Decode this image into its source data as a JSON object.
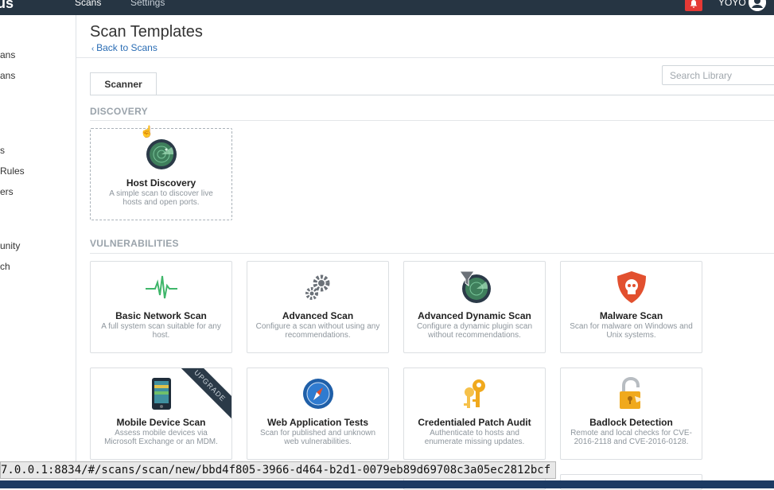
{
  "topbar": {
    "brand": "us",
    "nav_scans": "Scans",
    "nav_settings": "Settings",
    "user": "YOYO",
    "colors": {
      "bar": "#263543",
      "bell": "#e53935"
    }
  },
  "sidebar": {
    "items": [
      "ans",
      "ans",
      "s",
      "Rules",
      "ers",
      "unity",
      "ch"
    ]
  },
  "header": {
    "title": "Scan Templates",
    "back": "Back to Scans"
  },
  "tabs": [
    {
      "label": "Scanner"
    }
  ],
  "search": {
    "placeholder": "Search Library"
  },
  "sections": {
    "discovery": "DISCOVERY",
    "vulnerabilities": "VULNERABILITIES"
  },
  "discovery_cards": [
    {
      "title": "Host Discovery",
      "desc": "A simple scan to discover live hosts and open ports.",
      "icon": "radar-icon"
    }
  ],
  "vuln_cards": [
    {
      "title": "Basic Network Scan",
      "desc": "A full system scan suitable for any host.",
      "icon": "pulse-icon"
    },
    {
      "title": "Advanced Scan",
      "desc": "Configure a scan without using any recommendations.",
      "icon": "gears-icon"
    },
    {
      "title": "Advanced Dynamic Scan",
      "desc": "Configure a dynamic plugin scan without recommendations.",
      "icon": "filter-radar-icon"
    },
    {
      "title": "Malware Scan",
      "desc": "Scan for malware on Windows and Unix systems.",
      "icon": "skull-shield-icon"
    },
    {
      "title": "Mobile Device Scan",
      "desc": "Assess mobile devices via Microsoft Exchange or an MDM.",
      "icon": "phone-icon",
      "ribbon": "UPGRADE"
    },
    {
      "title": "Web Application Tests",
      "desc": "Scan for published and unknown web vulnerabilities.",
      "icon": "compass-icon"
    },
    {
      "title": "Credentialed Patch Audit",
      "desc": "Authenticate to hosts and enumerate missing updates.",
      "icon": "keys-icon"
    },
    {
      "title": "Badlock Detection",
      "desc": "Remote and local checks for CVE-2016-2118 and CVE-2016-0128.",
      "icon": "padlock-icon"
    }
  ],
  "status_url": "7.0.0.1:8834/#/scans/scan/new/bbd4f805-3966-d464-b2d1-0079eb89d69708c3a05ec2812bcf"
}
